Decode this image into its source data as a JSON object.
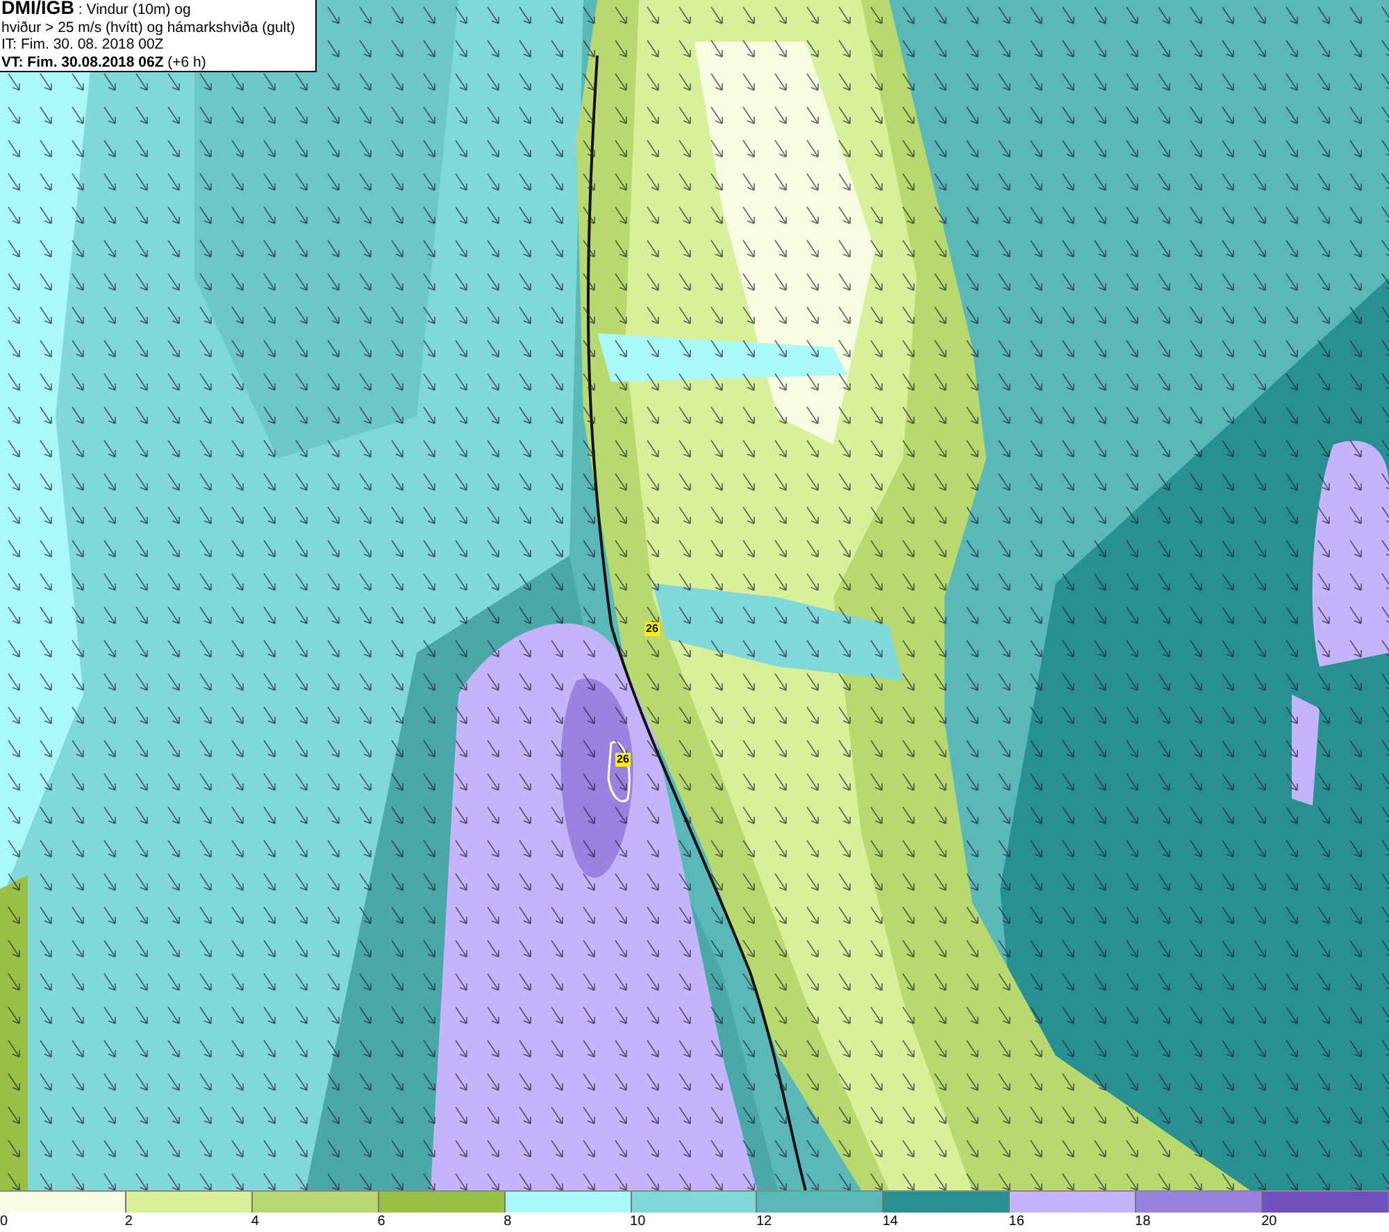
{
  "header": {
    "lines": [
      "**DMI/IGB** : Vindur (10m) og",
      "hviður > 25 m/s (hvítt) og hámarkshviða (gult)",
      "IT: Fim. 30. 08. 2018 00Z",
      "**VT: Fim. 30.08.2018 06Z** (+6 h)"
    ]
  },
  "map": {
    "gust_labels": [
      {
        "text": "26"
      },
      {
        "text": "26"
      }
    ]
  },
  "legend": {
    "bins": [
      {
        "color": "#f7fde0"
      },
      {
        "color": "#d8f09a"
      },
      {
        "color": "#b8d96e"
      },
      {
        "color": "#99bf45"
      },
      {
        "color": "#aaf8f8"
      },
      {
        "color": "#80d8d8"
      },
      {
        "color": "#5ab8b8"
      },
      {
        "color": "#289090"
      },
      {
        "color": "#c4b4fa"
      },
      {
        "color": "#9a82e0"
      },
      {
        "color": "#7050c0"
      }
    ],
    "ticks": [
      "0",
      "2",
      "4",
      "6",
      "8",
      "10",
      "12",
      "14",
      "16",
      "18",
      "20"
    ]
  }
}
